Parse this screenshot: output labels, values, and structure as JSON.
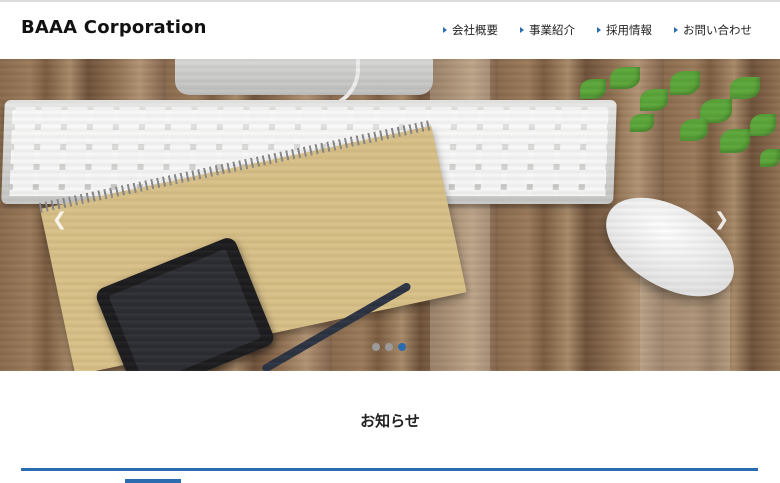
{
  "header": {
    "brand": "BAAA Corporation",
    "nav": [
      {
        "label": "会社概要",
        "icon": "triangle-right-icon"
      },
      {
        "label": "事業紹介",
        "icon": "triangle-right-icon"
      },
      {
        "label": "採用情報",
        "icon": "triangle-right-icon"
      },
      {
        "label": "お問い合わせ",
        "icon": "triangle-right-icon"
      }
    ]
  },
  "hero": {
    "prev_icon": "chevron-left-icon",
    "next_icon": "chevron-right-icon",
    "prev_glyph": "❮",
    "next_glyph": "❯",
    "slide_count": 3,
    "active_slide": 3
  },
  "news": {
    "title": "お知らせ"
  },
  "colors": {
    "accent": "#2b6cb0",
    "background": "#ffffff",
    "text": "#222222"
  }
}
